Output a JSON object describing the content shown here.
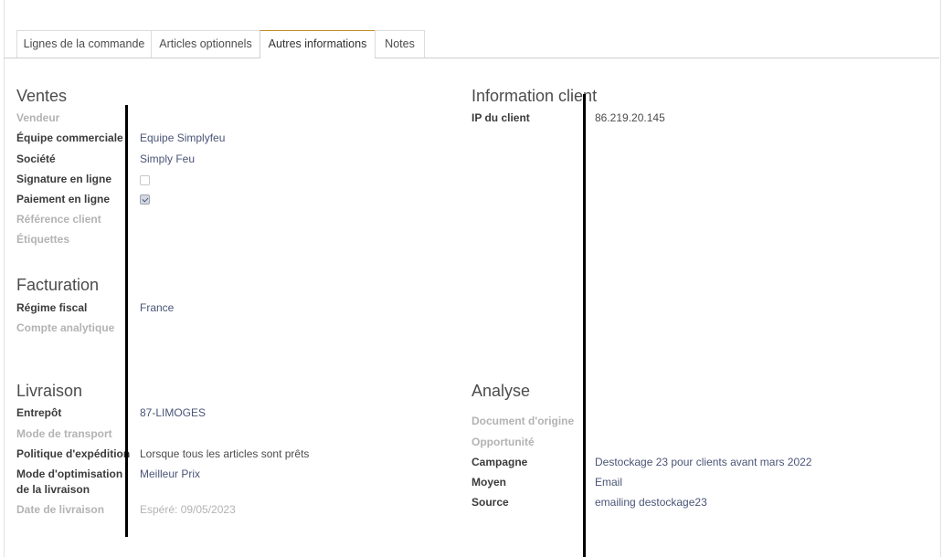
{
  "tabs": [
    {
      "label": "Lignes de la commande"
    },
    {
      "label": "Articles optionnels"
    },
    {
      "label": "Autres informations"
    },
    {
      "label": "Notes"
    }
  ],
  "ventes": {
    "title": "Ventes",
    "vendeur_label": "Vendeur",
    "equipe_label": "Équipe commerciale",
    "equipe_value": "Equipe Simplyfeu",
    "societe_label": "Société",
    "societe_value": "Simply Feu",
    "signature_label": "Signature en ligne",
    "signature_checked": false,
    "paiement_label": "Paiement en ligne",
    "paiement_checked": true,
    "reference_label": "Référence client",
    "etiquettes_label": "Étiquettes"
  },
  "facturation": {
    "title": "Facturation",
    "regime_label": "Régime fiscal",
    "regime_value": "France",
    "compte_label": "Compte analytique"
  },
  "livraison": {
    "title": "Livraison",
    "entrepot_label": "Entrepôt",
    "entrepot_value": "87-LIMOGES",
    "mode_transport_label": "Mode de transport",
    "politique_label": "Politique d'expédition",
    "politique_value": "Lorsque tous les articles sont prêts",
    "optim_label_line1": "Mode d'optimisation",
    "optim_label_line2": "de la livraison",
    "optim_value": "Meilleur Prix",
    "date_label": "Date de livraison",
    "date_value": "Espéré: 09/05/2023"
  },
  "client": {
    "title": "Information client",
    "ip_label": "IP du client",
    "ip_value": "86.219.20.145"
  },
  "analyse": {
    "title": "Analyse",
    "document_label": "Document d'origine",
    "opportunite_label": "Opportunité",
    "campagne_label": "Campagne",
    "campagne_value": "Destockage 23 pour clients avant mars 2022",
    "moyen_label": "Moyen",
    "moyen_value": "Email",
    "source_label": "Source",
    "source_value": "emailing destockage23"
  }
}
